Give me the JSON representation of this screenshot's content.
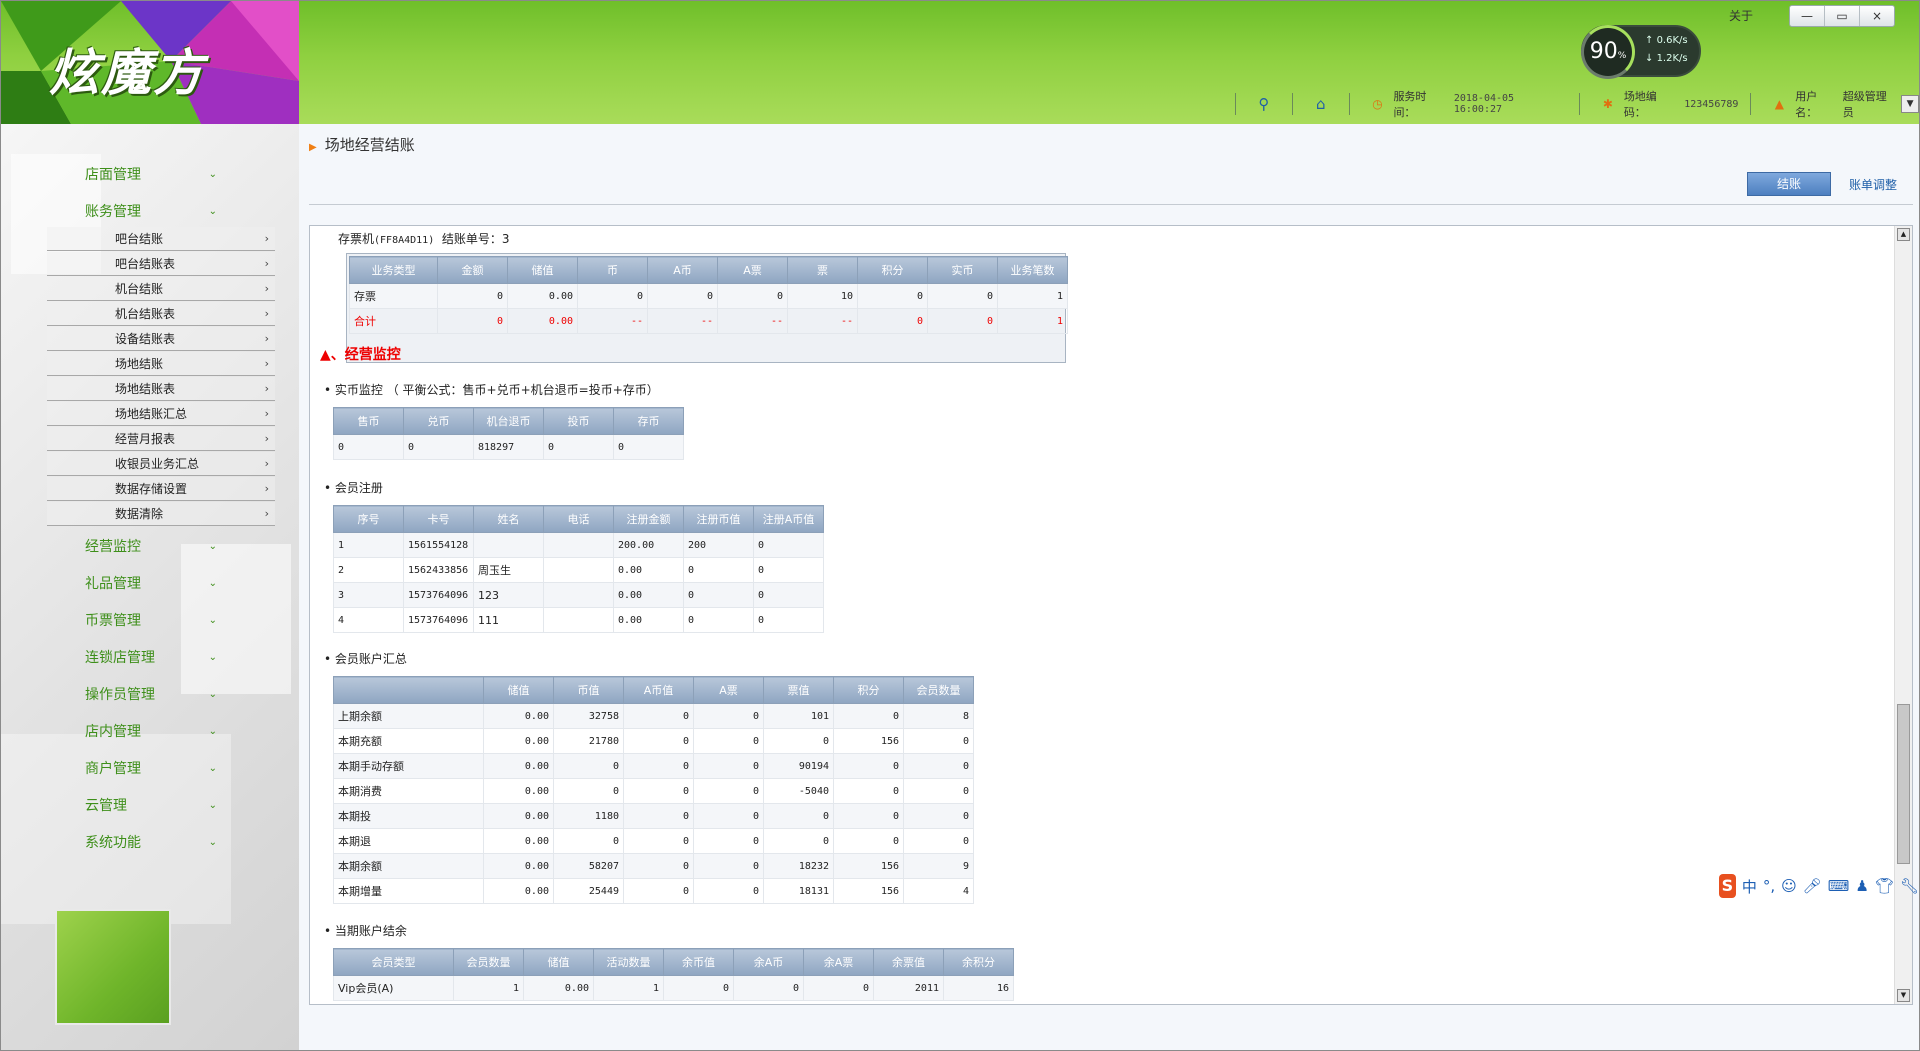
{
  "app": {
    "logo": "炫魔方",
    "about": "关于",
    "window_buttons": [
      "—",
      "▭",
      "×"
    ]
  },
  "speed": {
    "percent": "90",
    "percent_unit": "%",
    "up": "0.6",
    "up_unit": "K/s",
    "down": "1.2",
    "down_unit": "K/s"
  },
  "toolbar": {
    "service_time_label": "服务时间：",
    "service_time": "2018-04-05 16:00:27",
    "venue_code_label": "场地编码：",
    "venue_code": "123456789",
    "user_label": "用户名：",
    "user": "超级管理员"
  },
  "sidebar": {
    "top": [
      {
        "label": "店面管理"
      },
      {
        "label": "账务管理"
      }
    ],
    "sub": [
      {
        "label": "吧台结账"
      },
      {
        "label": "吧台结账表"
      },
      {
        "label": "机台结账"
      },
      {
        "label": "机台结账表"
      },
      {
        "label": "设备结账表"
      },
      {
        "label": "场地结账"
      },
      {
        "label": "场地结账表"
      },
      {
        "label": "场地结账汇总"
      },
      {
        "label": "经营月报表"
      },
      {
        "label": "收银员业务汇总"
      },
      {
        "label": "数据存储设置"
      },
      {
        "label": "数据清除"
      }
    ],
    "bottom": [
      {
        "label": "经营监控"
      },
      {
        "label": "礼品管理"
      },
      {
        "label": "币票管理"
      },
      {
        "label": "连锁店管理"
      },
      {
        "label": "操作员管理"
      },
      {
        "label": "店内管理"
      },
      {
        "label": "商户管理"
      },
      {
        "label": "云管理"
      },
      {
        "label": "系统功能"
      }
    ]
  },
  "page": {
    "title": "场地经营结账",
    "settle_button": "结账",
    "adjust_link": "账单调整"
  },
  "ticket_machine": {
    "caption_device": "存票机",
    "caption_id": "(FF8A4D11)",
    "caption_no_label": "结账单号：",
    "caption_no": "3",
    "headers": [
      "业务类型",
      "金额",
      "储值",
      "币",
      "A币",
      "A票",
      "票",
      "积分",
      "实币",
      "业务笔数"
    ],
    "rows": [
      [
        "存票",
        "0",
        "0.00",
        "0",
        "0",
        "0",
        "10",
        "0",
        "0",
        "1"
      ],
      [
        "合计",
        "0",
        "0.00",
        "--",
        "--",
        "--",
        "--",
        "0",
        "0",
        "1"
      ]
    ]
  },
  "monitor": {
    "title": "▲、经营监控"
  },
  "coin_monitor": {
    "title": "• 实币监控",
    "formula": "（ 平衡公式：售币+兑币+机台退币=投币+存币）",
    "headers": [
      "售币",
      "兑币",
      "机台退币",
      "投币",
      "存币"
    ],
    "rows": [
      [
        "0",
        "0",
        "818297",
        "0",
        "0"
      ]
    ]
  },
  "member_reg": {
    "title": "• 会员注册",
    "headers": [
      "序号",
      "卡号",
      "姓名",
      "电话",
      "注册金额",
      "注册币值",
      "注册A币值"
    ],
    "rows": [
      [
        "1",
        "1561554128",
        "",
        "",
        "200.00",
        "200",
        "0"
      ],
      [
        "2",
        "1562433856",
        "周玉生",
        "",
        "0.00",
        "0",
        "0"
      ],
      [
        "3",
        "1573764096",
        "123",
        "",
        "0.00",
        "0",
        "0"
      ],
      [
        "4",
        "1573764096",
        "111",
        "",
        "0.00",
        "0",
        "0"
      ]
    ]
  },
  "member_summary": {
    "title": "• 会员账户汇总",
    "headers": [
      "",
      "储值",
      "币值",
      "A币值",
      "A票",
      "票值",
      "积分",
      "会员数量"
    ],
    "rows": [
      [
        "上期余额",
        "0.00",
        "32758",
        "0",
        "0",
        "101",
        "0",
        "8"
      ],
      [
        "本期充额",
        "0.00",
        "21780",
        "0",
        "0",
        "0",
        "156",
        "0"
      ],
      [
        "本期手动存额",
        "0.00",
        "0",
        "0",
        "0",
        "90194",
        "0",
        "0"
      ],
      [
        "本期消费",
        "0.00",
        "0",
        "0",
        "0",
        "-5040",
        "0",
        "0"
      ],
      [
        "本期投",
        "0.00",
        "1180",
        "0",
        "0",
        "0",
        "0",
        "0"
      ],
      [
        "本期退",
        "0.00",
        "0",
        "0",
        "0",
        "0",
        "0",
        "0"
      ],
      [
        "本期余额",
        "0.00",
        "58207",
        "0",
        "0",
        "18232",
        "156",
        "9"
      ],
      [
        "本期增量",
        "0.00",
        "25449",
        "0",
        "0",
        "18131",
        "156",
        "4"
      ]
    ]
  },
  "period_balance": {
    "title": "• 当期账户结余",
    "headers": [
      "会员类型",
      "会员数量",
      "储值",
      "活动数量",
      "余币值",
      "余A币",
      "余A票",
      "余票值",
      "余积分"
    ],
    "rows": [
      [
        "Vip会员(A)",
        "1",
        "0.00",
        "1",
        "0",
        "0",
        "0",
        "2011",
        "16"
      ]
    ]
  },
  "ime": {
    "logo": "S",
    "mode": "中"
  },
  "colors": {
    "header_green": "#8fd040",
    "nav_green": "#3e8f1a",
    "accent_red": "#e00000",
    "button_blue": "#4d7fc0"
  }
}
